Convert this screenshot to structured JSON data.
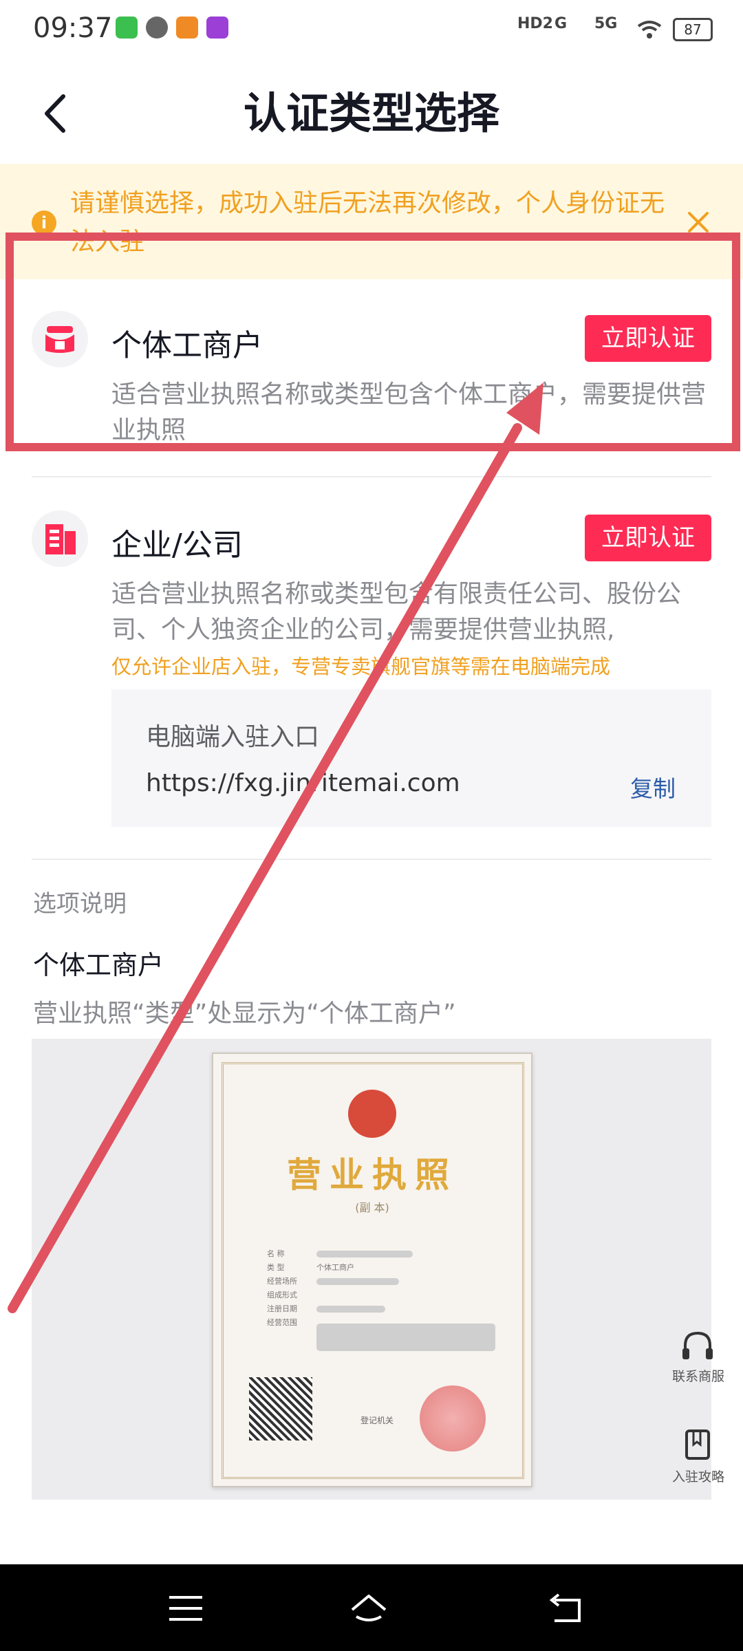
{
  "status_bar": {
    "time": "09:37",
    "right_indicators": [
      "HD2",
      "G",
      "5G"
    ],
    "battery": "87"
  },
  "header": {
    "title": "认证类型选择",
    "back_icon": "chevron-left-icon"
  },
  "notice": {
    "text": "请谨慎选择，成功入驻后无法再次修改，个人身份证无法入驻",
    "color": "#f0a020",
    "background": "#fff7e0"
  },
  "options": [
    {
      "title": "个体工商户",
      "button": "立即认证",
      "description": "适合营业执照名称或类型包含个体工商户，需要提供营业执照",
      "icon": "shop-icon"
    },
    {
      "title": "企业/公司",
      "button": "立即认证",
      "description": "适合营业执照名称或类型包含有限责任公司、股份公司、个人独资企业的公司，需要提供营业执照,",
      "warning": "仅允许企业店入驻，专营专卖旗舰官旗等需在电脑端完成",
      "icon": "building-icon",
      "pc_entry": {
        "label": "电脑端入驻入口",
        "url": "https://fxg.jinritemai.com",
        "copy": "复制"
      }
    }
  ],
  "explanation": {
    "label": "选项说明",
    "title": "个体工商户",
    "description": "营业执照“类型”处显示为“个体工商户”",
    "license": {
      "title": "营业执照",
      "subtitle": "(副 本)",
      "fields": [
        "名 称",
        "类 型",
        "经营场所",
        "组成形式",
        "注册日期",
        "经营范围"
      ],
      "type_value": "个体工商户",
      "authority": "登记机关"
    }
  },
  "floating": [
    {
      "label": "联系商服",
      "icon": "headset-icon"
    },
    {
      "label": "入驻攻略",
      "icon": "book-icon"
    }
  ],
  "colors": {
    "accent": "#fe2c55",
    "annotation": "#e0525f",
    "link": "#2b5ca8"
  }
}
